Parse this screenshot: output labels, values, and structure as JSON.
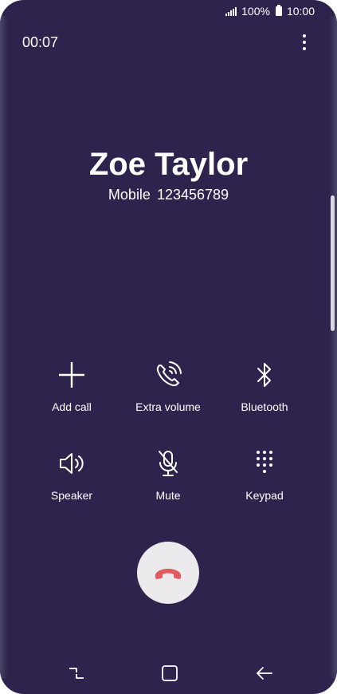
{
  "status_bar": {
    "battery": "100%",
    "time": "10:00"
  },
  "call": {
    "timer": "00:07",
    "caller_name": "Zoe Taylor",
    "number_type": "Mobile",
    "number": "123456789"
  },
  "actions": [
    {
      "label": "Add call",
      "icon": "plus-icon"
    },
    {
      "label": "Extra volume",
      "icon": "phone-volume-icon"
    },
    {
      "label": "Bluetooth",
      "icon": "bluetooth-icon"
    },
    {
      "label": "Speaker",
      "icon": "speaker-icon"
    },
    {
      "label": "Mute",
      "icon": "mic-off-icon"
    },
    {
      "label": "Keypad",
      "icon": "keypad-icon"
    }
  ],
  "colors": {
    "background": "#2d234c",
    "end_call_button": "#eceaed",
    "end_call_icon": "#e05a5f",
    "text": "#ffffff"
  }
}
